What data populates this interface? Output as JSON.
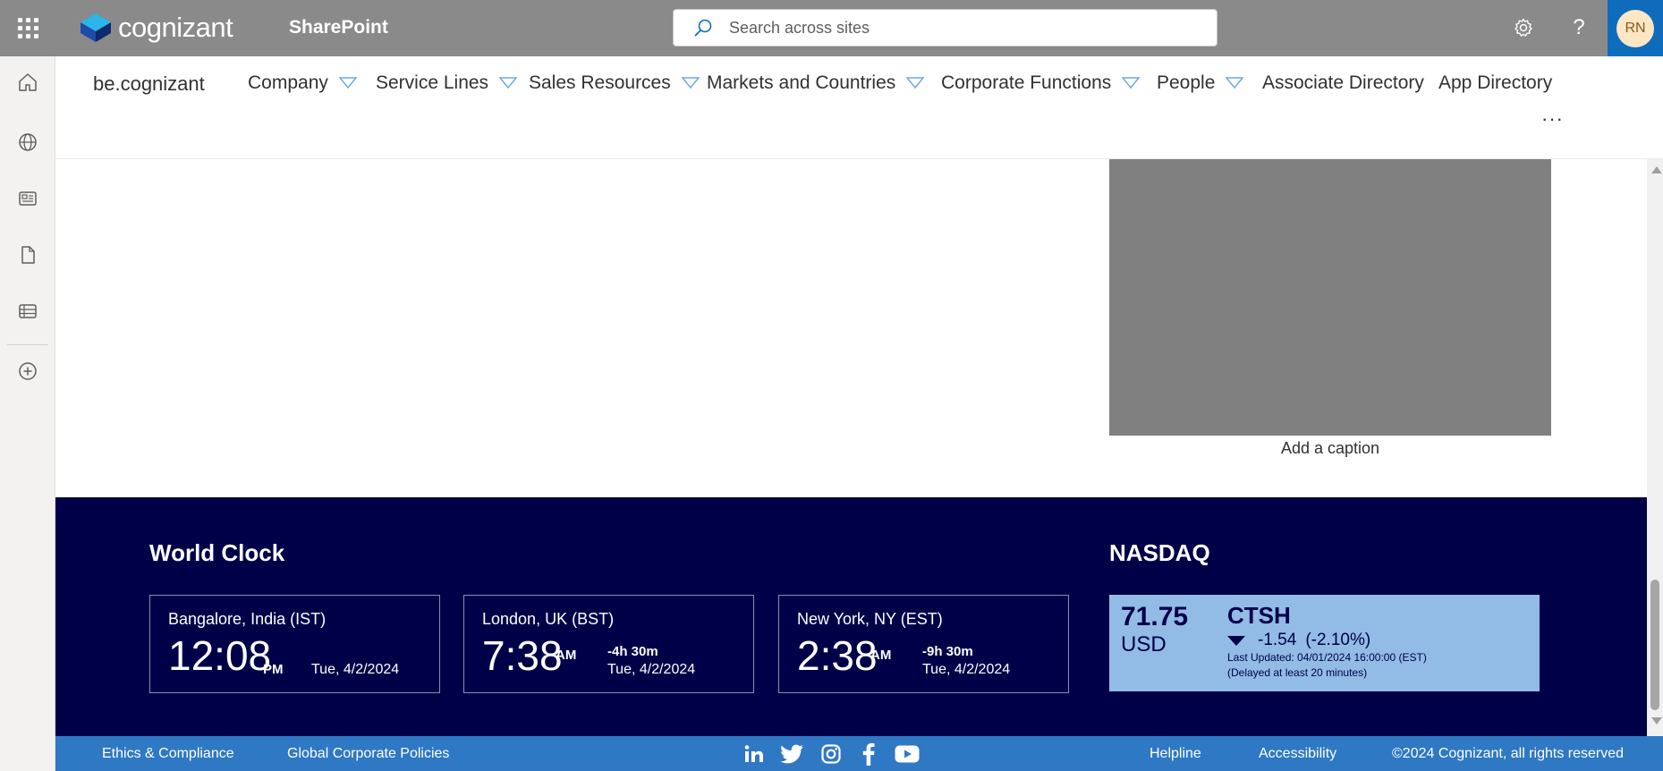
{
  "suitebar": {
    "app_launcher_icon": "waffle-icon",
    "logo_text": "cognizant",
    "app_name": "SharePoint",
    "search_placeholder": "Search across sites",
    "settings_icon": "gear-icon",
    "help_icon": "help-icon",
    "avatar_initials": "RN"
  },
  "appbar": {
    "items": [
      {
        "name": "home-icon"
      },
      {
        "name": "globe-icon"
      },
      {
        "name": "news-icon"
      },
      {
        "name": "file-icon"
      },
      {
        "name": "lists-icon"
      },
      {
        "name": "add-circle-icon"
      }
    ]
  },
  "sitenav": {
    "site_title": "be.cognizant",
    "items": [
      {
        "label": "Company",
        "has_menu": true
      },
      {
        "label": "Service Lines",
        "has_menu": true
      },
      {
        "label": "Sales Resources",
        "has_menu": true
      },
      {
        "label": "Markets and Countries",
        "has_menu": true
      },
      {
        "label": "Corporate Functions",
        "has_menu": true
      },
      {
        "label": "People",
        "has_menu": true
      },
      {
        "label": "Associate Directory",
        "has_menu": false
      },
      {
        "label": "App Directory",
        "has_menu": false
      }
    ],
    "more_label": "···"
  },
  "content": {
    "caption": "Add a caption"
  },
  "world_clock": {
    "title": "World Clock",
    "clocks": [
      {
        "city": "Bangalore, India (IST)",
        "time": "12:08",
        "ampm": "PM",
        "offset": "",
        "date": "Tue, 4/2/2024"
      },
      {
        "city": "London, UK (BST)",
        "time": "7:38",
        "ampm": "AM",
        "offset": "-4h 30m",
        "date": "Tue, 4/2/2024"
      },
      {
        "city": "New York, NY (EST)",
        "time": "2:38",
        "ampm": "AM",
        "offset": "-9h 30m",
        "date": "Tue, 4/2/2024"
      }
    ]
  },
  "nasdaq": {
    "title": "NASDAQ",
    "price": "71.75",
    "currency": "USD",
    "symbol": "CTSH",
    "change": "-1.54",
    "change_pct": "(-2.10%)",
    "direction": "down",
    "last_updated": "Last Updated: 04/01/2024 16:00:00 (EST)",
    "delay_note": "(Delayed at least 20 minutes)"
  },
  "footer": {
    "ethics": "Ethics & Compliance",
    "policies": "Global Corporate Policies",
    "social": [
      "linkedin-icon",
      "twitter-icon",
      "instagram-icon",
      "facebook-icon",
      "youtube-icon"
    ],
    "helpline": "Helpline",
    "accessibility": "Accessibility",
    "copyright": "©2024 Cognizant, all rights reserved"
  },
  "colors": {
    "suitebar": "#8a8a8a",
    "band": "#000048",
    "stock_card": "#92bbe6",
    "footer": "#2f78c4",
    "avatar_bg": "#0f6cbd"
  }
}
